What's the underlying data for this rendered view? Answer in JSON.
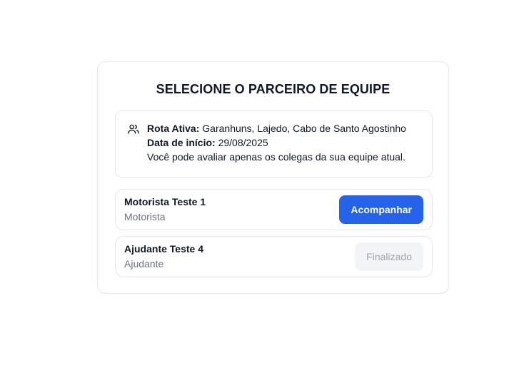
{
  "title": "SELECIONE O PARCEIRO DE EQUIPE",
  "info": {
    "icon": "users-icon",
    "route_label": "Rota Ativa:",
    "route_value": "Garanhuns, Lajedo, Cabo de Santo Agostinho",
    "start_label": "Data de início:",
    "start_value": "29/08/2025",
    "note": "Você pode avaliar apenas os colegas da sua equipe atual."
  },
  "partners": [
    {
      "name": "Motorista Teste 1",
      "role": "Motorista",
      "action": "Acompanhar",
      "action_state": "enabled"
    },
    {
      "name": "Ajudante Teste 4",
      "role": "Ajudante",
      "action": "Finalizado",
      "action_state": "disabled"
    }
  ],
  "colors": {
    "primary": "#2563eb",
    "border": "#e5e7eb",
    "muted_text": "#6b7280",
    "disabled_bg": "#f3f4f6",
    "disabled_text": "#9ca3af"
  }
}
